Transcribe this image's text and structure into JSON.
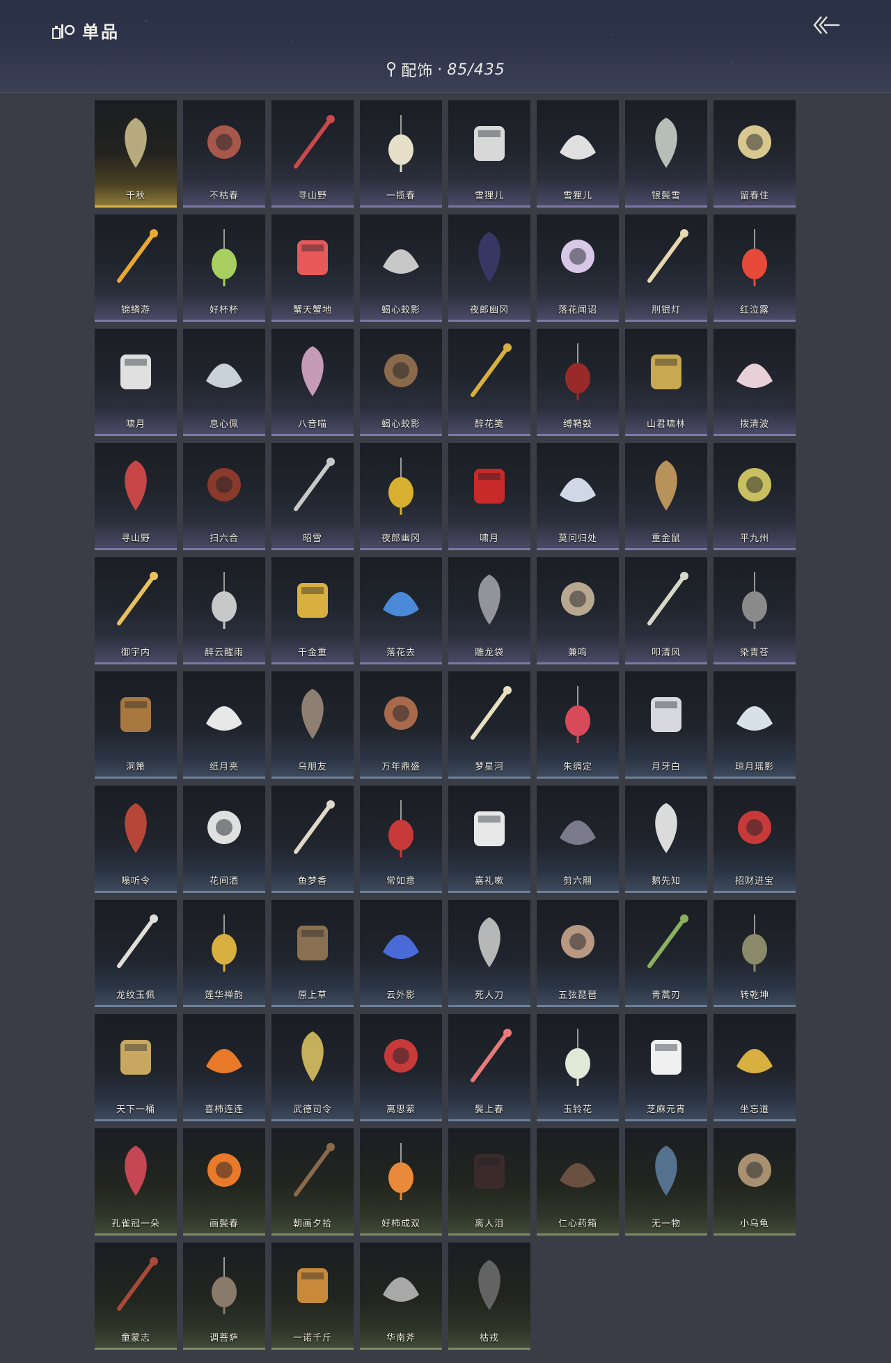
{
  "header": {
    "title": "单品",
    "category": "配饰",
    "separator": "·",
    "count": "85/435"
  },
  "items": [
    {
      "name": "千秋",
      "icon": "fishing-net-icon",
      "color": "#c9b98a",
      "selected": true
    },
    {
      "name": "不枯春",
      "icon": "branch-icon",
      "color": "#a8584a"
    },
    {
      "name": "寻山野",
      "icon": "abacus-icon",
      "color": "#c94a4a"
    },
    {
      "name": "一揽春",
      "icon": "flower-basket-icon",
      "color": "#e6e0c8"
    },
    {
      "name": "雪狸儿",
      "icon": "tail-icon",
      "color": "#d8d8d8"
    },
    {
      "name": "雪狸儿",
      "icon": "cat-ears-icon",
      "color": "#e0e0e0"
    },
    {
      "name": "银鬓雪",
      "icon": "feather-pair-icon",
      "color": "#c8cfc8"
    },
    {
      "name": "留春住",
      "icon": "hairpin-icon",
      "color": "#d8c890"
    },
    {
      "name": "锦鳞游",
      "icon": "golden-fish-icon",
      "color": "#e8a832"
    },
    {
      "name": "好杯杯",
      "icon": "cabbage-icon",
      "color": "#a8d060"
    },
    {
      "name": "蟹天蟹地",
      "icon": "crab-icon",
      "color": "#e85a5a"
    },
    {
      "name": "蝎心蛟影",
      "icon": "serpent-icon",
      "color": "#c8c8c8"
    },
    {
      "name": "夜郎幽冈",
      "icon": "dark-plume-icon",
      "color": "#3a3a6a"
    },
    {
      "name": "落花闻诏",
      "icon": "pendant-icon",
      "color": "#d8c8e8"
    },
    {
      "name": "刖银灯",
      "icon": "lantern-icon",
      "color": "#e8d8b0"
    },
    {
      "name": "红泣露",
      "icon": "red-figure-icon",
      "color": "#e84a3a"
    },
    {
      "name": "啸月",
      "icon": "white-tail-icon",
      "color": "#e0e0e0"
    },
    {
      "name": "息心佩",
      "icon": "jade-pendant-icon",
      "color": "#c8d0d8"
    },
    {
      "name": "八音喵",
      "icon": "cat-doll-icon",
      "color": "#d8a8c8"
    },
    {
      "name": "蝎心蛟影",
      "icon": "dagger-icon",
      "color": "#8a6a4a"
    },
    {
      "name": "醉花笺",
      "icon": "flower-stick-icon",
      "color": "#d8b040"
    },
    {
      "name": "缚鞘鼓",
      "icon": "drum-icon",
      "color": "#9a2a2a"
    },
    {
      "name": "山君啸林",
      "icon": "tiger-medallion-icon",
      "color": "#c8a850"
    },
    {
      "name": "拨清波",
      "icon": "duck-doll-icon",
      "color": "#e8d0d8"
    },
    {
      "name": "寻山野",
      "icon": "necklace-icon",
      "color": "#d84a4a"
    },
    {
      "name": "扫六合",
      "icon": "brush-icon",
      "color": "#8a3a2a"
    },
    {
      "name": "昭雪",
      "icon": "tassel-headpiece-icon",
      "color": "#c8c8c8"
    },
    {
      "name": "夜郎幽冈",
      "icon": "golden-crown-icon",
      "color": "#d8b030"
    },
    {
      "name": "啸月",
      "icon": "red-ears-icon",
      "color": "#c82a2a"
    },
    {
      "name": "莫问归处",
      "icon": "blossom-hairpin-icon",
      "color": "#d0d8e8"
    },
    {
      "name": "重金鼠",
      "icon": "golden-rat-icon",
      "color": "#c8a060"
    },
    {
      "name": "平九州",
      "icon": "tassel-icon",
      "color": "#c8c060"
    },
    {
      "name": "御宇内",
      "icon": "golden-birds-icon",
      "color": "#e8c060"
    },
    {
      "name": "醉云醒雨",
      "icon": "wind-chime-icon",
      "color": "#c8c8c8"
    },
    {
      "name": "千金重",
      "icon": "golden-toad-icon",
      "color": "#d8b040"
    },
    {
      "name": "落花去",
      "icon": "blue-flower-icon",
      "color": "#4a8ad8"
    },
    {
      "name": "雕龙袋",
      "icon": "cage-icon",
      "color": "#a0a0a8"
    },
    {
      "name": "兼鸣",
      "icon": "bagua-plate-icon",
      "color": "#b8a890"
    },
    {
      "name": "叩清风",
      "icon": "round-fan-icon",
      "color": "#d8d8c8"
    },
    {
      "name": "染青苍",
      "icon": "bead-string-icon",
      "color": "#8a8a8a"
    },
    {
      "name": "洞箫",
      "icon": "flute-icon",
      "color": "#a87840"
    },
    {
      "name": "纸月亮",
      "icon": "paper-moon-icon",
      "color": "#e8e8e8"
    },
    {
      "name": "乌朋友",
      "icon": "crow-hat-icon",
      "color": "#9a8a7a"
    },
    {
      "name": "万年鼎盛",
      "icon": "cauldron-icon",
      "color": "#a86a4a"
    },
    {
      "name": "梦星河",
      "icon": "flower-swing-icon",
      "color": "#e8e0c0"
    },
    {
      "name": "朱绸定",
      "icon": "red-knot-icon",
      "color": "#d84a5a"
    },
    {
      "name": "月牙白",
      "icon": "crescent-blade-icon",
      "color": "#d8d8e0"
    },
    {
      "name": "琼月瑶影",
      "icon": "crescent-pendant-icon",
      "color": "#d8e0e8"
    },
    {
      "name": "嗡听令",
      "icon": "round-charm-icon",
      "color": "#c84a3a"
    },
    {
      "name": "花间酒",
      "icon": "gourd-icon",
      "color": "#e0e0e0"
    },
    {
      "name": "鱼梦香",
      "icon": "sachet-icon",
      "color": "#e0d8c8"
    },
    {
      "name": "常如意",
      "icon": "tassel-knot-icon",
      "color": "#c83a3a"
    },
    {
      "name": "嘉礼嗽",
      "icon": "bear-doll-icon",
      "color": "#e8e8e8"
    },
    {
      "name": "剪六翮",
      "icon": "sword-icon",
      "color": "#7a7a8a"
    },
    {
      "name": "鹅先知",
      "icon": "goose-icon",
      "color": "#f0f0f0"
    },
    {
      "name": "招财进宝",
      "icon": "charm-string-icon",
      "color": "#c83a3a"
    },
    {
      "name": "龙纹玉佩",
      "icon": "jade-disc-icon",
      "color": "#e0e0d8"
    },
    {
      "name": "莲华禅韵",
      "icon": "lotus-icon",
      "color": "#d8b040"
    },
    {
      "name": "原上草",
      "icon": "grass-bundle-icon",
      "color": "#8a7050"
    },
    {
      "name": "云外影",
      "icon": "kite-icon",
      "color": "#4a6ad8"
    },
    {
      "name": "死人刀",
      "icon": "blade-icon",
      "color": "#c8c8c8"
    },
    {
      "name": "五弦琵琶",
      "icon": "pipa-icon",
      "color": "#b89880"
    },
    {
      "name": "青蒿刃",
      "icon": "green-blade-icon",
      "color": "#8ab060"
    },
    {
      "name": "转乾坤",
      "icon": "compass-charm-icon",
      "color": "#8a8a6a"
    },
    {
      "name": "天下一桶",
      "icon": "bucket-icon",
      "color": "#c8a860"
    },
    {
      "name": "喜柿连连",
      "icon": "persimmon-icon",
      "color": "#e87a2a"
    },
    {
      "name": "武德司令",
      "icon": "token-icon",
      "color": "#d8c060"
    },
    {
      "name": "离思萦",
      "icon": "red-cord-icon",
      "color": "#c83a3a"
    },
    {
      "name": "鬓上春",
      "icon": "peony-icon",
      "color": "#e87a7a"
    },
    {
      "name": "玉铃花",
      "icon": "lily-icon",
      "color": "#e0e8d8"
    },
    {
      "name": "芝麻元宵",
      "icon": "panda-icon",
      "color": "#f0f0f0"
    },
    {
      "name": "坐忘道",
      "icon": "golden-flower-icon",
      "color": "#d8b040"
    },
    {
      "name": "孔雀冠一朵",
      "icon": "red-blossom-icon",
      "color": "#d84a5a"
    },
    {
      "name": "画鬓春",
      "icon": "orange-lily-icon",
      "color": "#e87a2a"
    },
    {
      "name": "朝画夕拾",
      "icon": "paintbrush-icon",
      "color": "#8a6a4a"
    },
    {
      "name": "好柿成双",
      "icon": "persimmon-hairpin-icon",
      "color": "#e88a3a"
    },
    {
      "name": "离人泪",
      "icon": "wine-jar-icon",
      "color": "#3a2a2a"
    },
    {
      "name": "仁心药箱",
      "icon": "medicine-chest-icon",
      "color": "#6a5040"
    },
    {
      "name": "无一物",
      "icon": "cloth-bag-icon",
      "color": "#5a7a9a"
    },
    {
      "name": "小乌龟",
      "icon": "turtle-icon",
      "color": "#a89070"
    },
    {
      "name": "童蒙志",
      "icon": "twin-tassels-icon",
      "color": "#a84a3a"
    },
    {
      "name": "调菩萨",
      "icon": "charm-cluster-icon",
      "color": "#8a7a6a"
    },
    {
      "name": "一诺千斤",
      "icon": "roast-chicken-icon",
      "color": "#c88a3a"
    },
    {
      "name": "华南斧",
      "icon": "axe-icon",
      "color": "#a8a8a8"
    },
    {
      "name": "枯戎",
      "icon": "dry-branch-icon",
      "color": "#6a6a6a"
    }
  ]
}
